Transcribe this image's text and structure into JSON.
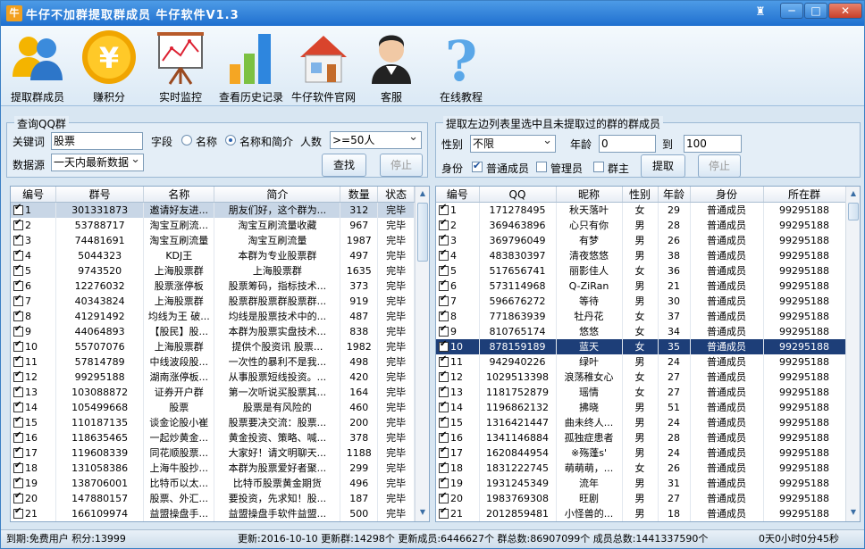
{
  "window": {
    "title": "牛仔不加群提取群成员  牛仔软件V1.3",
    "app_icon": "牛",
    "min": "─",
    "max": "□",
    "close": "✕"
  },
  "toolbar": [
    {
      "label": "提取群成员",
      "icon": "users-icon"
    },
    {
      "label": "赚积分",
      "icon": "coin-yen-icon"
    },
    {
      "label": "实时监控",
      "icon": "chart-board-icon"
    },
    {
      "label": "查看历史记录",
      "icon": "bar-chart-icon"
    },
    {
      "label": "牛仔软件官网",
      "icon": "home-icon"
    },
    {
      "label": "客服",
      "icon": "support-agent-icon"
    },
    {
      "label": "在线教程",
      "icon": "help-question-icon"
    }
  ],
  "query": {
    "group_title": "查询QQ群",
    "keyword_label": "关键词",
    "keyword_value": "股票",
    "field_label": "字段",
    "opt_name": "名称",
    "opt_name_intro": "名称和简介",
    "people_label": "人数",
    "people_value": ">=50人",
    "source_label": "数据源",
    "source_value": "一天内最新数据",
    "search_button": "查找",
    "stop_button": "停止"
  },
  "extract": {
    "group_title": "提取左边列表里选中且未提取过的群的群成员",
    "gender_label": "性别",
    "gender_value": "不限",
    "age_label": "年龄",
    "age_from": "0",
    "age_to_label": "到",
    "age_to": "100",
    "role_label": "身份",
    "role_normal": "普通成员",
    "role_admin": "管理员",
    "role_owner": "群主",
    "extract_button": "提取",
    "stop_button": "停止"
  },
  "groups_table": {
    "columns": [
      "编号",
      "群号",
      "名称",
      "简介",
      "数量",
      "状态"
    ],
    "rows": [
      [
        "1",
        "301331873",
        "邀请好友进...",
        "朋友们好，这个群为...",
        "312",
        "完毕"
      ],
      [
        "2",
        "53788717",
        "淘宝互刷流...",
        "淘宝互刷流量收藏",
        "967",
        "完毕"
      ],
      [
        "3",
        "74481691",
        "淘宝互刷流量",
        "淘宝互刷流量",
        "1987",
        "完毕"
      ],
      [
        "4",
        "5044323",
        "KDJ王",
        "本群为专业股票群",
        "497",
        "完毕"
      ],
      [
        "5",
        "9743520",
        "上海股票群",
        "上海股票群",
        "1635",
        "完毕"
      ],
      [
        "6",
        "12276032",
        "股票涨停板",
        "股票筹码，指标技术...",
        "373",
        "完毕"
      ],
      [
        "7",
        "40343824",
        "上海股票群",
        "股票群股票群股票群...",
        "919",
        "完毕"
      ],
      [
        "8",
        "41291492",
        "均线为王 破...",
        "均线是股票技术中的...",
        "487",
        "完毕"
      ],
      [
        "9",
        "44064893",
        "【股民】股...",
        "本群为股票实盘技术...",
        "838",
        "完毕"
      ],
      [
        "10",
        "55707076",
        "上海股票群",
        "提供个股资讯 股票...",
        "1982",
        "完毕"
      ],
      [
        "11",
        "57814789",
        "中线波段股...",
        "一次性的暴利不是我...",
        "498",
        "完毕"
      ],
      [
        "12",
        "99295188",
        "湖南涨停板...",
        "从事股票短线投资。...",
        "420",
        "完毕"
      ],
      [
        "13",
        "103088872",
        "证券开户群",
        "第一次听说买股票其...",
        "164",
        "完毕"
      ],
      [
        "14",
        "105499668",
        "股票",
        "股票是有风险的",
        "460",
        "完毕"
      ],
      [
        "15",
        "110187135",
        "谈金论股小崔",
        "股票要决交流：股票...",
        "200",
        "完毕"
      ],
      [
        "16",
        "118635465",
        "一起炒黄金...",
        "黄金投资、策略、喊...",
        "378",
        "完毕"
      ],
      [
        "17",
        "119608339",
        "同花顺股票...",
        "大家好！请文明聊天...",
        "1188",
        "完毕"
      ],
      [
        "18",
        "131058386",
        "上海牛股抄...",
        "本群为股票爱好者聚...",
        "299",
        "完毕"
      ],
      [
        "19",
        "138706001",
        "比特币以太...",
        "比特币股票黄金期货",
        "496",
        "完毕"
      ],
      [
        "20",
        "147880157",
        "股票、外汇...",
        "要投资，先求知！股...",
        "187",
        "完毕"
      ],
      [
        "21",
        "166109974",
        "益盟操盘手...",
        "益盟操盘手软件益盟...",
        "500",
        "完毕"
      ]
    ]
  },
  "members_table": {
    "columns": [
      "编号",
      "QQ",
      "昵称",
      "性别",
      "年龄",
      "身份",
      "所在群"
    ],
    "rows": [
      [
        "1",
        "171278495",
        "秋天落叶",
        "女",
        "29",
        "普通成员",
        "99295188"
      ],
      [
        "2",
        "369463896",
        "心只有你",
        "男",
        "28",
        "普通成员",
        "99295188"
      ],
      [
        "3",
        "369796049",
        "有梦",
        "男",
        "26",
        "普通成员",
        "99295188"
      ],
      [
        "4",
        "483830397",
        "清夜悠悠",
        "男",
        "38",
        "普通成员",
        "99295188"
      ],
      [
        "5",
        "517656741",
        "丽影佳人",
        "女",
        "36",
        "普通成员",
        "99295188"
      ],
      [
        "6",
        "573114968",
        "Q-ZiRan",
        "男",
        "21",
        "普通成员",
        "99295188"
      ],
      [
        "7",
        "596676272",
        "等待",
        "男",
        "30",
        "普通成员",
        "99295188"
      ],
      [
        "8",
        "771863939",
        "牡丹花",
        "女",
        "37",
        "普通成员",
        "99295188"
      ],
      [
        "9",
        "810765174",
        "悠悠",
        "女",
        "34",
        "普通成员",
        "99295188"
      ],
      [
        "10",
        "878159189",
        "蓝天",
        "女",
        "35",
        "普通成员",
        "99295188"
      ],
      [
        "11",
        "942940226",
        "绿叶",
        "男",
        "24",
        "普通成员",
        "99295188"
      ],
      [
        "12",
        "1029513398",
        "浪荡稚女心",
        "女",
        "27",
        "普通成员",
        "99295188"
      ],
      [
        "13",
        "1181752879",
        "瑶情",
        "女",
        "27",
        "普通成员",
        "99295188"
      ],
      [
        "14",
        "1196862132",
        "拂晓",
        "男",
        "51",
        "普通成员",
        "99295188"
      ],
      [
        "15",
        "1316421447",
        "曲未终人...",
        "男",
        "24",
        "普通成员",
        "99295188"
      ],
      [
        "16",
        "1341146884",
        "孤独症患者",
        "男",
        "28",
        "普通成员",
        "99295188"
      ],
      [
        "17",
        "1620844954",
        "※殇蓬s'",
        "男",
        "24",
        "普通成员",
        "99295188"
      ],
      [
        "18",
        "1831222745",
        "萌萌萌，...",
        "女",
        "26",
        "普通成员",
        "99295188"
      ],
      [
        "19",
        "1931245349",
        "流年",
        "男",
        "31",
        "普通成员",
        "99295188"
      ],
      [
        "20",
        "1983769308",
        "旺剧",
        "男",
        "27",
        "普通成员",
        "99295188"
      ],
      [
        "21",
        "2012859481",
        "小怪兽的...",
        "男",
        "18",
        "普通成员",
        "99295188"
      ]
    ]
  },
  "status": {
    "expire": "到期:免费用户 积分:13999",
    "update": "更新:2016-10-10 更新群:14298个 更新成员:6446627个 群总数:86907099个 成员总数:1441337590个",
    "timer": "0天0小时0分45秒"
  }
}
